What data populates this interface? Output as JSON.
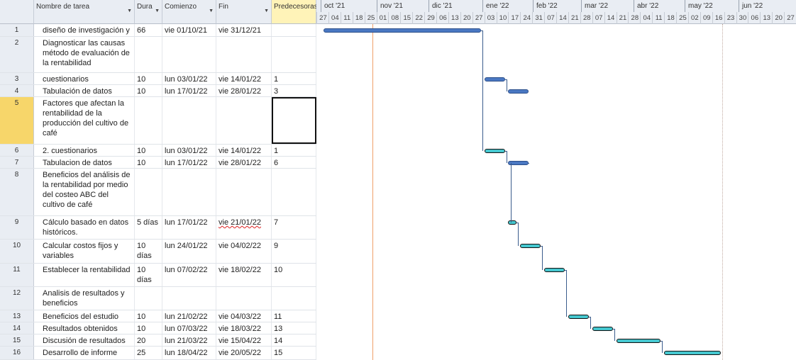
{
  "headers": {
    "name": "Nombre de tarea",
    "duration": "Dura",
    "start": "Comienzo",
    "end": "Fin",
    "predecessors": "Predecesoras"
  },
  "months": [
    "oct '21",
    "nov '21",
    "dic '21",
    "ene '22",
    "feb '22",
    "mar '22",
    "abr '22",
    "may '22",
    "jun '22"
  ],
  "days": [
    "27",
    "04",
    "11",
    "18",
    "25",
    "01",
    "08",
    "15",
    "22",
    "29",
    "06",
    "13",
    "20",
    "27",
    "03",
    "10",
    "17",
    "24",
    "31",
    "07",
    "14",
    "21",
    "28",
    "07",
    "14",
    "21",
    "28",
    "04",
    "11",
    "18",
    "25",
    "02",
    "09",
    "16",
    "23",
    "30",
    "06",
    "13",
    "20",
    "27"
  ],
  "rows": [
    {
      "id": "1",
      "name": "diseño de investigación y",
      "duration": "66 días",
      "start": "vie 01/10/21",
      "end": "vie 31/12/21",
      "pred": ""
    },
    {
      "id": "2",
      "name": "Diagnosticar las causas método de evaluación de la rentabilidad",
      "duration": "",
      "start": "",
      "end": "",
      "pred": ""
    },
    {
      "id": "3",
      "name": "cuestionarios",
      "duration": "10 días",
      "start": "lun 03/01/22",
      "end": "vie 14/01/22",
      "pred": "1"
    },
    {
      "id": "4",
      "name": "Tabulación de datos",
      "duration": "10 días",
      "start": "lun 17/01/22",
      "end": "vie 28/01/22",
      "pred": "3"
    },
    {
      "id": "5",
      "name": "Factores que afectan la rentabilidad de la producción del cultivo de café",
      "duration": "",
      "start": "",
      "end": "",
      "pred": ""
    },
    {
      "id": "6",
      "name": "2. cuestionarios",
      "duration": "10 días",
      "start": "lun 03/01/22",
      "end": "vie 14/01/22",
      "pred": "1"
    },
    {
      "id": "7",
      "name": "Tabulacion de datos",
      "duration": "10 días",
      "start": "lun 17/01/22",
      "end": "vie 28/01/22",
      "pred": "6"
    },
    {
      "id": "8",
      "name": "Beneficios del análisis de la rentabilidad por medio del costeo ABC del cultivo de café",
      "duration": "",
      "start": "",
      "end": "",
      "pred": ""
    },
    {
      "id": "9",
      "name": "Cálculo basado en datos históricos.",
      "duration": "5 días",
      "start": "lun 17/01/22",
      "end": "vie 21/01/22",
      "pred": "7"
    },
    {
      "id": "10",
      "name": "Calcular costos fijos y variables",
      "duration": "10 días",
      "start": "lun 24/01/22",
      "end": "vie 04/02/22",
      "pred": "9"
    },
    {
      "id": "11",
      "name": "Establecer la rentabilidad",
      "duration": "10 días",
      "start": "lun 07/02/22",
      "end": "vie 18/02/22",
      "pred": "10"
    },
    {
      "id": "12",
      "name": "Analisis de resultados y beneficios",
      "duration": "",
      "start": "",
      "end": "",
      "pred": ""
    },
    {
      "id": "13",
      "name": "Beneficios del estudio",
      "duration": "10 días",
      "start": "lun 21/02/22",
      "end": "vie 04/03/22",
      "pred": "11"
    },
    {
      "id": "14",
      "name": "Resultados obtenidos",
      "duration": "10 días",
      "start": "lun 07/03/22",
      "end": "vie 18/03/22",
      "pred": "13"
    },
    {
      "id": "15",
      "name": "Discusión de resultados",
      "duration": "20 días",
      "start": "lun 21/03/22",
      "end": "vie 15/04/22",
      "pred": "14"
    },
    {
      "id": "16",
      "name": "Desarrollo de informe",
      "duration": "25",
      "start": "lun 18/04/22",
      "end": "vie 20/05/22",
      "pred": "15"
    }
  ],
  "colors": {
    "summary": "#4a78c2",
    "task": "#45c7cf",
    "today_line": "#f0a06a"
  }
}
